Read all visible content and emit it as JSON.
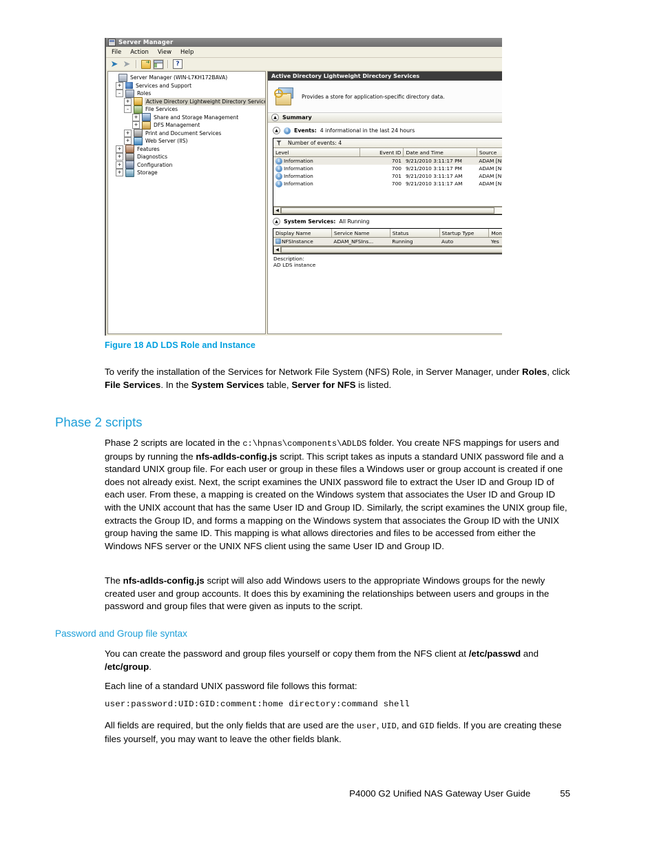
{
  "figure": {
    "window": {
      "title": "Server Manager",
      "menu": [
        "File",
        "Action",
        "View",
        "Help"
      ],
      "toolbar_icons": [
        "back-arrow-icon",
        "forward-arrow-icon",
        "up-folder-icon",
        "show-hide-tree-icon",
        "help-icon"
      ],
      "tree": [
        {
          "label": "Server Manager (WIN-L7KH172BAVA)",
          "indent": 0,
          "expander": "",
          "icon": "server-icon",
          "selected": false
        },
        {
          "label": "Services and Support",
          "indent": 1,
          "expander": "+",
          "icon": "help-circle-icon",
          "selected": false
        },
        {
          "label": "Roles",
          "indent": 1,
          "expander": "-",
          "icon": "roles-icon",
          "selected": false
        },
        {
          "label": "Active Directory Lightweight Directory Services",
          "indent": 2,
          "expander": "+",
          "icon": "adlds-icon",
          "selected": true
        },
        {
          "label": "File Services",
          "indent": 2,
          "expander": "-",
          "icon": "file-services-icon",
          "selected": false
        },
        {
          "label": "Share and Storage Management",
          "indent": 3,
          "expander": "+",
          "icon": "share-storage-icon",
          "selected": false
        },
        {
          "label": "DFS Management",
          "indent": 3,
          "expander": "+",
          "icon": "dfs-icon",
          "selected": false
        },
        {
          "label": "Print and Document Services",
          "indent": 2,
          "expander": "+",
          "icon": "print-icon",
          "selected": false
        },
        {
          "label": "Web Server (IIS)",
          "indent": 2,
          "expander": "+",
          "icon": "iis-icon",
          "selected": false
        },
        {
          "label": "Features",
          "indent": 1,
          "expander": "+",
          "icon": "features-icon",
          "selected": false
        },
        {
          "label": "Diagnostics",
          "indent": 1,
          "expander": "+",
          "icon": "diagnostics-icon",
          "selected": false
        },
        {
          "label": "Configuration",
          "indent": 1,
          "expander": "+",
          "icon": "configuration-icon",
          "selected": false
        },
        {
          "label": "Storage",
          "indent": 1,
          "expander": "+",
          "icon": "storage-icon",
          "selected": false
        }
      ],
      "detail": {
        "header": "Active Directory Lightweight Directory Services",
        "intro_text": "Provides a store for application-specific directory data.",
        "summary_label": "Summary",
        "events": {
          "label": "Events:",
          "status": "4 informational in the last 24 hours",
          "filter_label": "Number of events: 4",
          "columns": [
            "Level",
            "Event ID",
            "Date and Time",
            "Source"
          ],
          "rows": [
            {
              "level": "Information",
              "event_id": "701",
              "datetime": "9/21/2010 3:11:17 PM",
              "source": "ADAM [NF"
            },
            {
              "level": "Information",
              "event_id": "700",
              "datetime": "9/21/2010 3:11:17 PM",
              "source": "ADAM [NF"
            },
            {
              "level": "Information",
              "event_id": "701",
              "datetime": "9/21/2010 3:11:17 AM",
              "source": "ADAM [NF"
            },
            {
              "level": "Information",
              "event_id": "700",
              "datetime": "9/21/2010 3:11:17 AM",
              "source": "ADAM [NF"
            }
          ]
        },
        "system_services": {
          "label": "System Services:",
          "status": "All Running",
          "columns": [
            "Display Name",
            "Service Name",
            "Status",
            "Startup Type",
            "Monitor"
          ],
          "rows": [
            {
              "display_name": "NFSInstance",
              "service_name": "ADAM_NFSIns...",
              "status": "Running",
              "startup_type": "Auto",
              "monitor": "Yes"
            }
          ],
          "description_label": "Description:",
          "description_value": "AD LDS instance"
        }
      }
    },
    "caption": "Figure 18 AD LDS Role and Instance"
  },
  "content": {
    "verify_paragraph": {
      "p1": "To verify the installation of the Services for Network File System (NFS) Role, in Server Manager, under ",
      "b1": "Roles",
      "p2": ", click ",
      "b2": "File Services",
      "p3": ". In the ",
      "b3": "System Services",
      "p4": " table, ",
      "b4": "Server for NFS",
      "p5": " is listed."
    },
    "phase2_heading": "Phase 2 scripts",
    "phase2_p1": {
      "p1": "Phase 2 scripts are located in the ",
      "c1": "c:\\hpnas\\components\\ADLDS",
      "p2": " folder. You create NFS mappings for users and groups by running the ",
      "b1": "nfs-adlds-config.js",
      "p3": " script. This script takes as inputs a standard UNIX password file and a standard UNIX group file. For each user or group in these files a Windows user or group account is created if one does not already exist. Next, the script examines the UNIX password file to extract the User ID and Group ID of each user. From these, a mapping is created on the Windows system that associates the User ID and Group ID with the UNIX account that has the same User ID and Group ID. Similarly, the script examines the UNIX group file, extracts the Group ID, and forms a mapping on the Windows system that associates the Group ID with the UNIX group having the same ID. This mapping is what allows directories and files to be accessed from either the Windows NFS server or the UNIX NFS client using the same User ID and Group ID."
    },
    "phase2_p2": {
      "p1": "The ",
      "b1": "nfs-adlds-config.js",
      "p2": " script will also add Windows users to the appropriate Windows groups for the newly created user and group accounts. It does this by examining the relationships between users and groups in the password and group files that were given as inputs to the script."
    },
    "password_heading": "Password and Group file syntax",
    "password_p1": {
      "p1": "You can create the password and group files yourself or copy them from the NFS client at ",
      "b1": "/etc/passwd",
      "p2": " and ",
      "b2": "/etc/group",
      "p3": "."
    },
    "password_p2": "Each line of a standard UNIX password file follows this format:",
    "password_code": "user:password:UID:GID:comment:home directory:command shell",
    "password_p3": {
      "p1": "All fields are required, but the only fields that are used are the ",
      "c1": "user",
      "p2": ", ",
      "c2": "UID",
      "p3": ", and ",
      "c3": "GID",
      "p4": " fields. If you are creating these files yourself, you may want to leave the other fields blank."
    }
  },
  "footer": {
    "title": "P4000 G2 Unified NAS Gateway User Guide",
    "page_number": "55"
  },
  "colors": {
    "heading_blue": "#1b9ed8",
    "caption_blue": "#00a0df"
  }
}
